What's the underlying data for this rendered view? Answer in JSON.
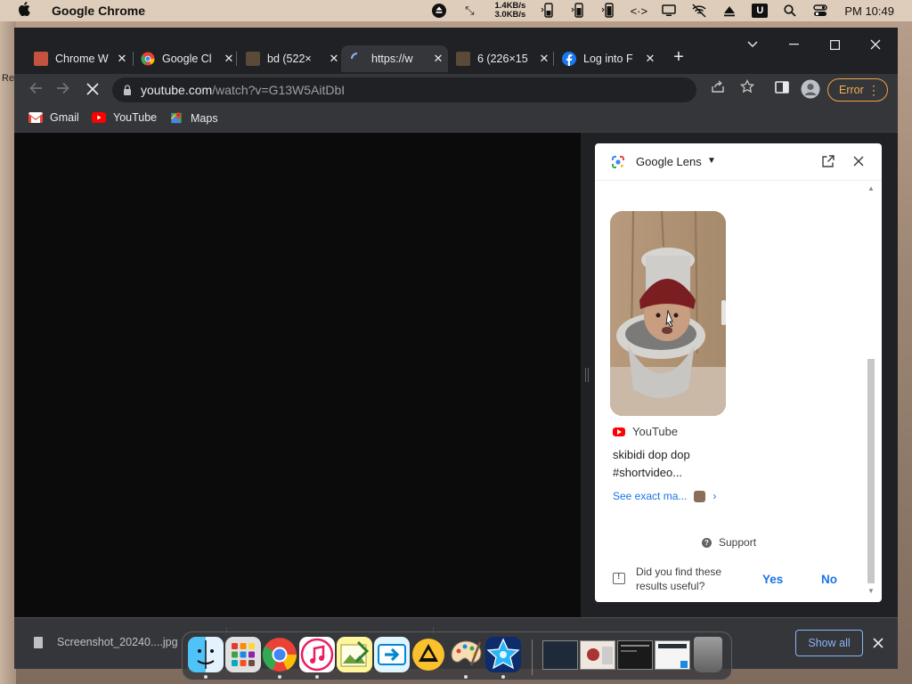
{
  "menubar": {
    "app_name": "Google Chrome",
    "net_up": "1.4KB/s",
    "net_down": "3.0KB/s",
    "clock": "PM 10:49",
    "u_badge": "U"
  },
  "tabs": [
    {
      "label": "Chrome W",
      "active": false
    },
    {
      "label": "Google Cl",
      "active": false
    },
    {
      "label": "bd (522×",
      "active": false
    },
    {
      "label": "https://w",
      "active": true
    },
    {
      "label": "6 (226×15",
      "active": false
    },
    {
      "label": "Log into F",
      "active": false
    }
  ],
  "toolbar": {
    "url_host": "youtube.com",
    "url_path": "/watch?v=G13W5AitDbI",
    "error_label": "Error"
  },
  "bookmarks": [
    {
      "label": "Gmail"
    },
    {
      "label": "YouTube"
    },
    {
      "label": "Maps"
    }
  ],
  "lens": {
    "title": "Google Lens",
    "result_source": "YouTube",
    "result_title": "skibidi dop dop #shortvideo...",
    "exact_match_label": "See exact ma...",
    "support_label": "Support",
    "feedback_question": "Did you find these results useful?",
    "yes_label": "Yes",
    "no_label": "No"
  },
  "downloads": {
    "file_name": "Screenshot_20240....jpg",
    "show_all_label": "Show all"
  },
  "colors": {
    "accent_blue": "#1a73e8",
    "error_orange": "#f6ae55",
    "youtube_red": "#ff0000"
  }
}
